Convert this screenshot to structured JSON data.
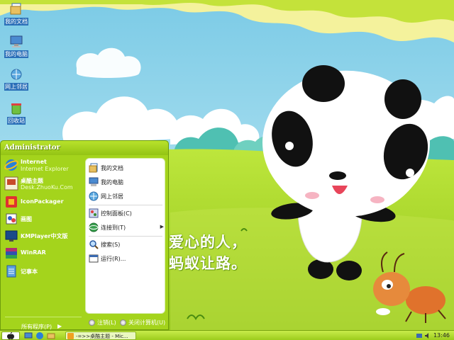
{
  "desktop": {
    "icons": [
      {
        "label": "我的文档",
        "icon": "my-documents-icon"
      },
      {
        "label": "我的电脑",
        "icon": "my-computer-icon"
      },
      {
        "label": "网上邻居",
        "icon": "network-places-icon"
      },
      {
        "label": "回收站",
        "icon": "recycle-bin-icon"
      }
    ],
    "slogan": [
      "爱心的人，",
      "蚂蚁让路。"
    ]
  },
  "start_menu": {
    "user": "Administrator",
    "programs": [
      {
        "title": "Internet",
        "subtitle": "Internet Explorer",
        "icon": "internet-explorer-icon"
      },
      {
        "title": "桌酷主题",
        "subtitle": "Desk.ZhuoKu.Com",
        "icon": "zhuoku-theme-icon"
      },
      {
        "title": "IconPackager",
        "subtitle": "",
        "icon": "iconpackager-icon"
      },
      {
        "title": "画图",
        "subtitle": "",
        "icon": "paint-icon"
      },
      {
        "title": "KMPlayer中文版",
        "subtitle": "",
        "icon": "kmplayer-icon"
      },
      {
        "title": "WinRAR",
        "subtitle": "",
        "icon": "winrar-icon"
      },
      {
        "title": "记事本",
        "subtitle": "",
        "icon": "notepad-icon"
      }
    ],
    "all_programs": "所有程序(P)",
    "places": [
      {
        "label": "我的文档",
        "icon": "my-documents-icon"
      },
      {
        "label": "我的电脑",
        "icon": "my-computer-icon"
      },
      {
        "label": "网上邻居",
        "icon": "network-places-icon"
      },
      {
        "label": "控制面板(C)",
        "icon": "control-panel-icon"
      },
      {
        "label": "连接到(T)",
        "icon": "connect-to-icon"
      },
      {
        "label": "搜索(S)",
        "icon": "search-icon"
      },
      {
        "label": "运行(R)...",
        "icon": "run-icon"
      }
    ],
    "logoff": "注销(L)",
    "shutdown": "关闭计算机(U)"
  },
  "taskbar": {
    "task_title": "-=>>桌酷主题 - Mic...",
    "clock": "13:46"
  },
  "colors": {
    "accent": "#a4d41c",
    "sky": "#9ed8ee",
    "grass": "#a6d628"
  }
}
